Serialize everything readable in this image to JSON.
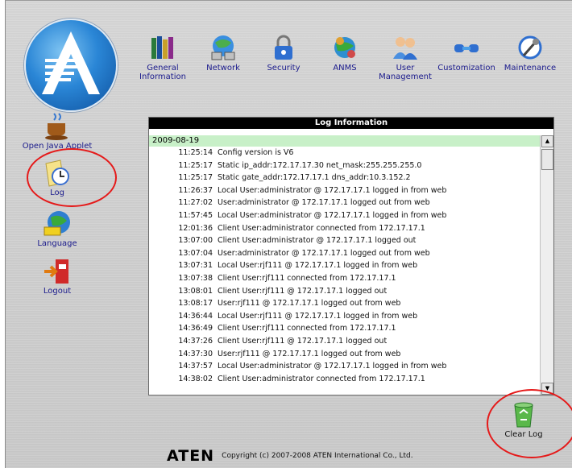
{
  "nav": [
    {
      "label": "General\nInformation",
      "icon": "books-icon"
    },
    {
      "label": "Network",
      "icon": "network-icon"
    },
    {
      "label": "Security",
      "icon": "lock-icon"
    },
    {
      "label": "ANMS",
      "icon": "anms-icon"
    },
    {
      "label": "User\nManagement",
      "icon": "users-icon"
    },
    {
      "label": "Customization",
      "icon": "customization-icon"
    },
    {
      "label": "Maintenance",
      "icon": "maintenance-icon"
    }
  ],
  "sidebar": [
    {
      "label": "Open Java Applet",
      "icon": "coffee-cup-icon"
    },
    {
      "label": "Log",
      "icon": "log-clock-icon"
    },
    {
      "label": "Language",
      "icon": "globe-icon"
    },
    {
      "label": "Logout",
      "icon": "logout-icon"
    }
  ],
  "log": {
    "title": "Log Information",
    "date": "2009-08-19",
    "entries": [
      {
        "time": "11:25:14",
        "message": "Config version is V6"
      },
      {
        "time": "11:25:17",
        "message": "Static ip_addr:172.17.17.30 net_mask:255.255.255.0"
      },
      {
        "time": "11:25:17",
        "message": "Static gate_addr:172.17.17.1 dns_addr:10.3.152.2"
      },
      {
        "time": "11:26:37",
        "message": "Local User:administrator @ 172.17.17.1 logged in from web"
      },
      {
        "time": "11:27:02",
        "message": "User:administrator @ 172.17.17.1 logged out from web"
      },
      {
        "time": "11:57:45",
        "message": "Local User:administrator @ 172.17.17.1 logged in from web"
      },
      {
        "time": "12:01:36",
        "message": "Client User:administrator connected from 172.17.17.1"
      },
      {
        "time": "13:07:00",
        "message": "Client User:administrator @ 172.17.17.1 logged out"
      },
      {
        "time": "13:07:04",
        "message": "User:administrator @ 172.17.17.1 logged out from web"
      },
      {
        "time": "13:07:31",
        "message": "Local User:rjf111 @ 172.17.17.1 logged in from web"
      },
      {
        "time": "13:07:38",
        "message": "Client User:rjf111 connected from 172.17.17.1"
      },
      {
        "time": "13:08:01",
        "message": "Client User:rjf111 @ 172.17.17.1 logged out"
      },
      {
        "time": "13:08:17",
        "message": "User:rjf111 @ 172.17.17.1 logged out from web"
      },
      {
        "time": "14:36:44",
        "message": "Local User:rjf111 @ 172.17.17.1 logged in from web"
      },
      {
        "time": "14:36:49",
        "message": "Client User:rjf111 connected from 172.17.17.1"
      },
      {
        "time": "14:37:26",
        "message": "Client User:rjf111 @ 172.17.17.1 logged out"
      },
      {
        "time": "14:37:30",
        "message": "User:rjf111 @ 172.17.17.1 logged out from web"
      },
      {
        "time": "14:37:57",
        "message": "Local User:administrator @ 172.17.17.1 logged in from web"
      },
      {
        "time": "14:38:02",
        "message": "Client User:administrator connected from 172.17.17.1"
      }
    ]
  },
  "clear_log": {
    "label": "Clear Log",
    "icon": "recycle-bin-icon"
  },
  "footer": {
    "brand": "ATEN",
    "copyright": "Copyright (c) 2007-2008 ATEN International Co., Ltd."
  },
  "colors": {
    "label_text": "#1a1a8c",
    "log_title_bg": "#000000",
    "date_row_bg": "#c8f0c8",
    "annotation_circle": "#e51a1a"
  }
}
